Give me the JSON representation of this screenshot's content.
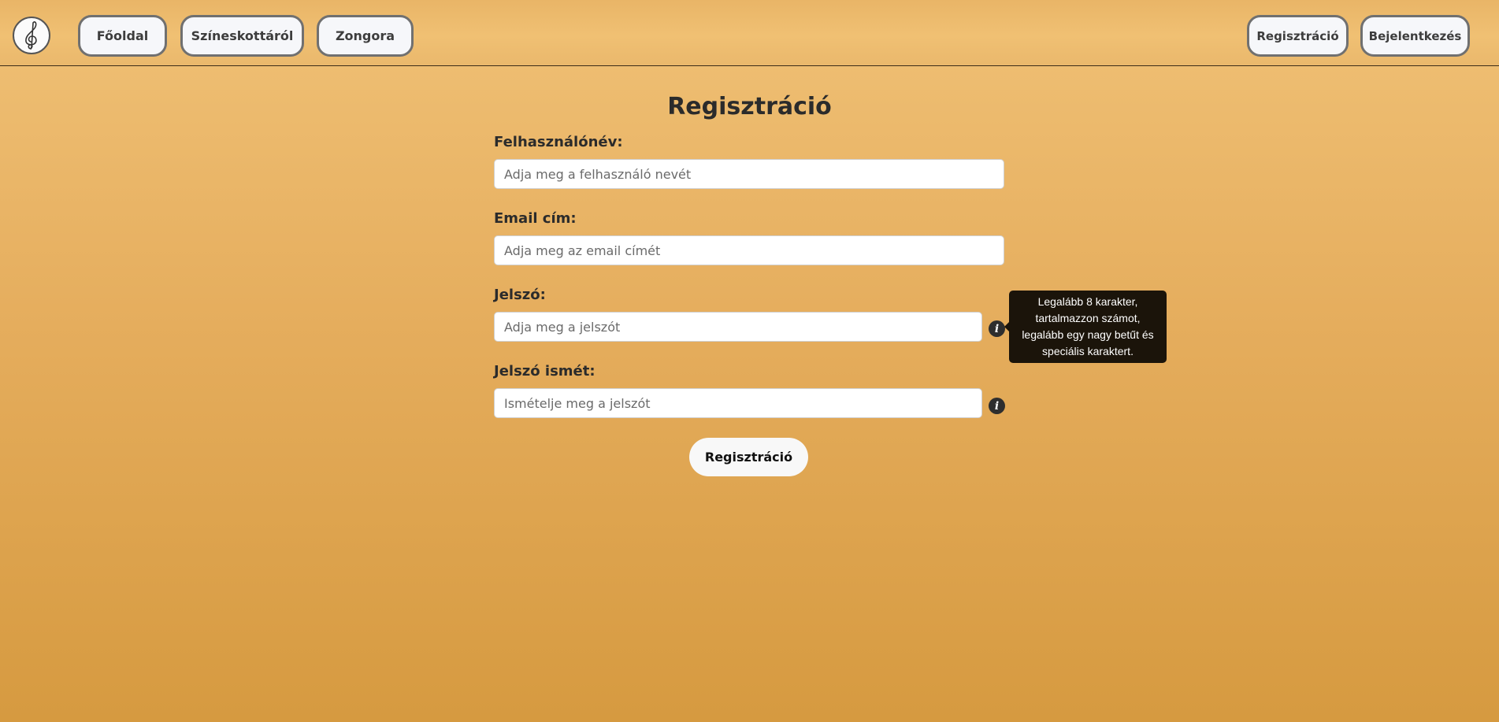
{
  "header": {
    "logo_icon": "treble-clef-icon",
    "nav_left": [
      {
        "label": "Főoldal"
      },
      {
        "label": "Színeskottáról"
      },
      {
        "label": "Zongora"
      }
    ],
    "nav_right": [
      {
        "label": "Regisztráció"
      },
      {
        "label": "Bejelentkezés"
      }
    ]
  },
  "form": {
    "title": "Regisztráció",
    "fields": [
      {
        "label": "Felhasználónév:",
        "placeholder": "Adja meg a felhasználó nevét",
        "value": ""
      },
      {
        "label": "Email cím:",
        "placeholder": "Adja meg az email címét",
        "value": ""
      },
      {
        "label": "Jelszó:",
        "placeholder": "Adja meg a jelszót",
        "value": ""
      },
      {
        "label": "Jelszó ismét:",
        "placeholder": "Ismételje meg a jelszót",
        "value": ""
      }
    ],
    "info_icon": "info-icon",
    "tooltip": "Legalább 8 karakter, tartalmazzon számot, legalább egy nagy betűt és speciális karaktert.",
    "submit_label": "Regisztráció"
  },
  "colors": {
    "background_top": "#f0c176",
    "background_bottom": "#d69a40",
    "button_bg": "#f6f7fa",
    "button_border": "#707070",
    "tooltip_bg": "#1b140a"
  }
}
